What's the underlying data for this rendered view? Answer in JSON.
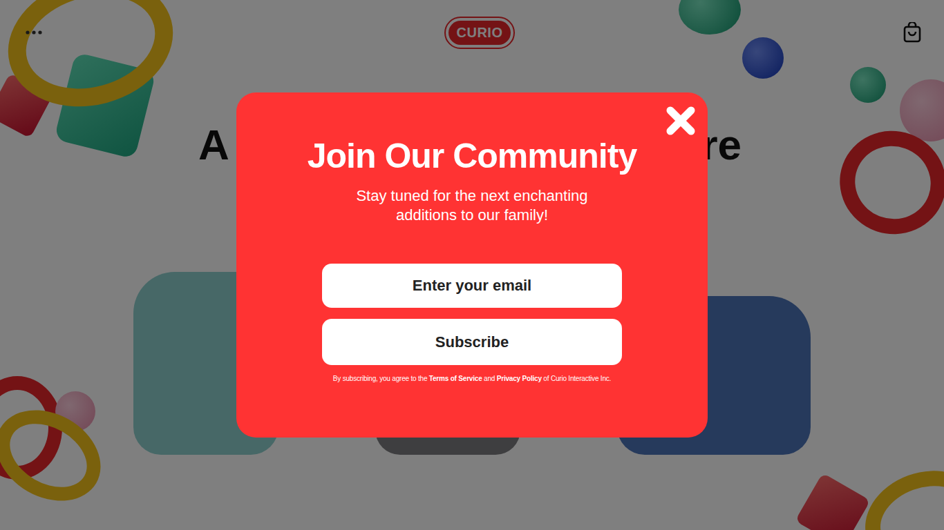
{
  "header": {
    "logo": "CURIO"
  },
  "hero": {
    "title_left": "A",
    "title_right": "re"
  },
  "modal": {
    "title": "Join Our Community",
    "subtitle": "Stay tuned for the next enchanting additions to our family!",
    "email_placeholder": "Enter your email",
    "subscribe_button": "Subscribe",
    "legal": {
      "prefix": "By subscribing, you agree to the ",
      "terms": "Terms of Service",
      "joiner": " and ",
      "privacy": "Privacy Policy",
      "suffix": " of Curio Interactive Inc."
    }
  }
}
